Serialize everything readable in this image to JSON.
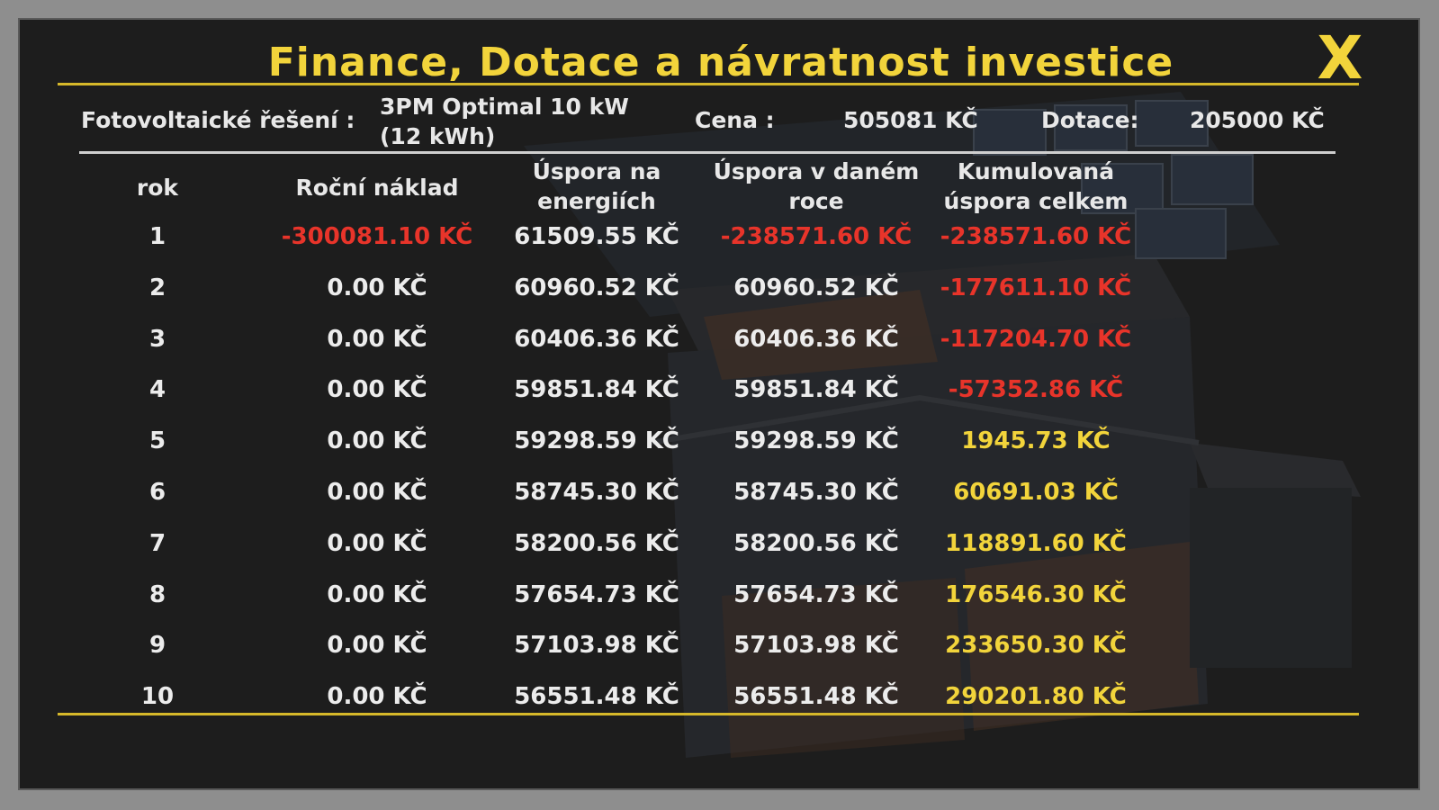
{
  "title": "Finance, Dotace a návratnost investice",
  "close_label": "X",
  "info": {
    "solution_label": "Fotovoltaické řešení :",
    "solution_value": "3PM Optimal 10 kW (12 kWh)",
    "price_label": "Cena :",
    "price_value": "505081 KČ",
    "subsidy_label": "Dotace:",
    "subsidy_value": "205000 KČ"
  },
  "table": {
    "headers": [
      "rok",
      "Roční náklad",
      "Úspora na energiích",
      "Úspora v daném roce",
      "Kumulovaná úspora celkem"
    ],
    "rows": [
      {
        "year": "1",
        "annual_cost": "-300081.10 KČ",
        "energy_saving": "61509.55 KČ",
        "year_saving": "-238571.60 KČ",
        "cumulative": "-238571.60 KČ",
        "cost_neg": true,
        "year_neg": true,
        "cum_neg": true
      },
      {
        "year": "2",
        "annual_cost": "0.00 KČ",
        "energy_saving": "60960.52 KČ",
        "year_saving": "60960.52 KČ",
        "cumulative": "-177611.10 KČ",
        "cost_neg": false,
        "year_neg": false,
        "cum_neg": true
      },
      {
        "year": "3",
        "annual_cost": "0.00 KČ",
        "energy_saving": "60406.36 KČ",
        "year_saving": "60406.36 KČ",
        "cumulative": "-117204.70 KČ",
        "cost_neg": false,
        "year_neg": false,
        "cum_neg": true
      },
      {
        "year": "4",
        "annual_cost": "0.00 KČ",
        "energy_saving": "59851.84 KČ",
        "year_saving": "59851.84 KČ",
        "cumulative": "-57352.86 KČ",
        "cost_neg": false,
        "year_neg": false,
        "cum_neg": true
      },
      {
        "year": "5",
        "annual_cost": "0.00 KČ",
        "energy_saving": "59298.59 KČ",
        "year_saving": "59298.59 KČ",
        "cumulative": "1945.73 KČ",
        "cost_neg": false,
        "year_neg": false,
        "cum_neg": false
      },
      {
        "year": "6",
        "annual_cost": "0.00 KČ",
        "energy_saving": "58745.30 KČ",
        "year_saving": "58745.30 KČ",
        "cumulative": "60691.03 KČ",
        "cost_neg": false,
        "year_neg": false,
        "cum_neg": false
      },
      {
        "year": "7",
        "annual_cost": "0.00 KČ",
        "energy_saving": "58200.56 KČ",
        "year_saving": "58200.56 KČ",
        "cumulative": "118891.60 KČ",
        "cost_neg": false,
        "year_neg": false,
        "cum_neg": false
      },
      {
        "year": "8",
        "annual_cost": "0.00 KČ",
        "energy_saving": "57654.73 KČ",
        "year_saving": "57654.73 KČ",
        "cumulative": "176546.30 KČ",
        "cost_neg": false,
        "year_neg": false,
        "cum_neg": false
      },
      {
        "year": "9",
        "annual_cost": "0.00 KČ",
        "energy_saving": "57103.98 KČ",
        "year_saving": "57103.98 KČ",
        "cumulative": "233650.30 KČ",
        "cost_neg": false,
        "year_neg": false,
        "cum_neg": false
      },
      {
        "year": "10",
        "annual_cost": "0.00 KČ",
        "energy_saving": "56551.48 KČ",
        "year_saving": "56551.48 KČ",
        "cumulative": "290201.80 KČ",
        "cost_neg": false,
        "year_neg": false,
        "cum_neg": false
      }
    ]
  },
  "colors": {
    "accent": "#f2d43b",
    "negative": "#e8342a",
    "text": "#ececec",
    "panel": "#1e1e1e"
  }
}
